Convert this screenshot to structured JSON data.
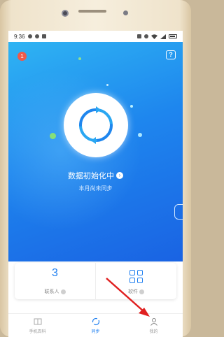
{
  "status_bar": {
    "time": "9:36"
  },
  "hero": {
    "notification_count": "1",
    "help_label": "?",
    "sync_status_title": "数据初始化中",
    "sync_status_arrow": "›",
    "sync_status_subtitle": "本月尚未同步"
  },
  "summary": {
    "contacts": {
      "count": "3",
      "label": "联系人"
    },
    "apps": {
      "label": "软件"
    }
  },
  "bottom_nav": {
    "items": [
      {
        "label": "手机百科",
        "icon": "book-icon",
        "active": false
      },
      {
        "label": "同步",
        "icon": "sync-icon",
        "active": true
      },
      {
        "label": "我的",
        "icon": "person-icon",
        "active": false
      }
    ]
  },
  "colors": {
    "accent": "#1f7ff0",
    "hero_top": "#2fb4f3",
    "hero_bottom": "#1a63e3",
    "badge": "#ef5a4a",
    "annotation_arrow": "#e02020"
  }
}
